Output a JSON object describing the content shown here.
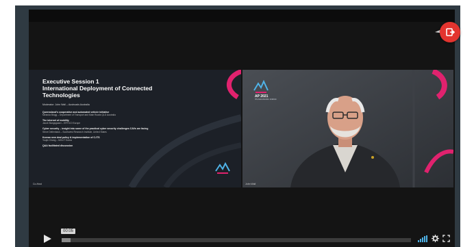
{
  "slide": {
    "title_line1": "Executive Session 1",
    "title_line2": "International Deployment of Connected",
    "title_line3": "Technologies",
    "moderator": "Moderator: John Wall – Austroads Australia",
    "agenda": [
      {
        "title": "Queensland's cooperative and automated vehicle initiative",
        "speaker": "Miranda Blogg – Department of Transport and Main Roads QLD Australia"
      },
      {
        "title": "The internet of mobility",
        "speaker": "Jacob Bangsgaard – ERTICO Europe"
      },
      {
        "title": "Cyber security – insight into some of the practical cyber security challenges CAVs are facing",
        "speaker": "Steve Dellenback – Southwest Research Institute, United States"
      },
      {
        "title": "Korean new deal policy & implementation of C-ITS",
        "speaker": "Youjin Chang – MOLIT Korea"
      },
      {
        "title": "Q&A facilitated discussion",
        "speaker": ""
      }
    ],
    "caption": "Co-Host"
  },
  "camera": {
    "logo_text": "AP 2021",
    "logo_sub": "ITS ASIA PACIFIC FORUM",
    "caption": "John Wall"
  },
  "controls": {
    "time": "00:05",
    "progress": 0.025
  },
  "colors": {
    "accent": "#e3342f",
    "magenta": "#e0226e",
    "player_bg": "#141414"
  }
}
